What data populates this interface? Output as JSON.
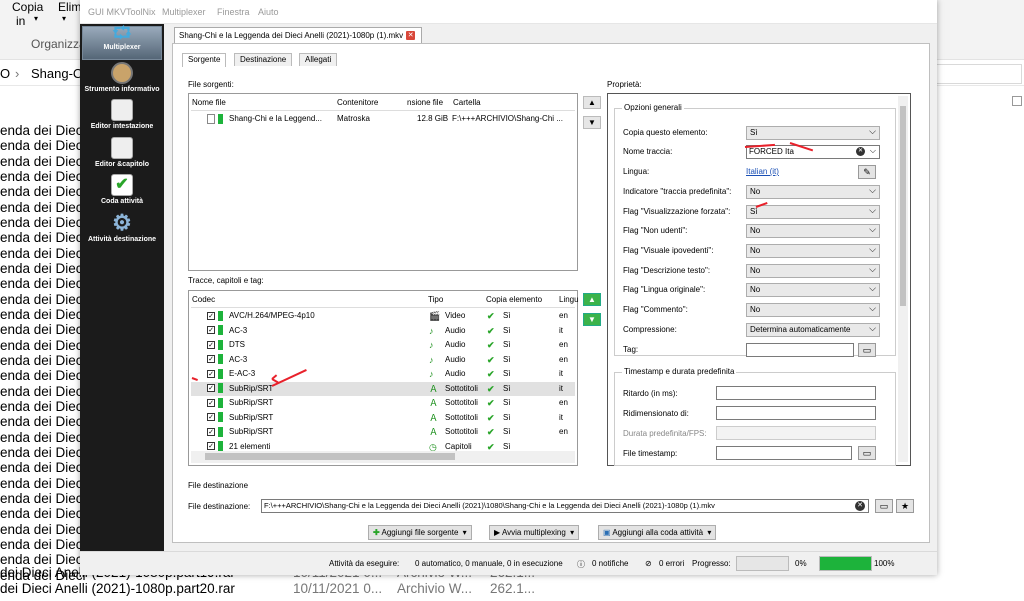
{
  "explorer": {
    "ribbon": {
      "copy_label": "Copia",
      "in_label": "in",
      "delete_label": "Elimi",
      "organize_label": "Organizza"
    },
    "address_left": "O",
    "address_path": "Shang-C",
    "rows": [
      "enda dei Dieci",
      "enda dei Dieci",
      "enda dei Dieci",
      "enda dei Dieci",
      "enda dei Dieci",
      "enda dei Dieci",
      "enda dei Dieci",
      "enda dei Dieci",
      "enda dei Dieci",
      "enda dei Dieci",
      "enda dei Dieci",
      "enda dei Dieci",
      "enda dei Dieci",
      "enda dei Dieci",
      "enda dei Dieci",
      "enda dei Dieci",
      "enda dei Dieci",
      "enda dei Dieci",
      "enda dei Dieci",
      "enda dei Dieci",
      "enda dei Dieci",
      "enda dei Dieci",
      "enda dei Dieci",
      "enda dei Dieci",
      "enda dei Dieci",
      "enda dei Dieci",
      "enda dei Dieci",
      "enda dei Dieci",
      "enda dei Dieci",
      "enda dei Dieci"
    ],
    "bottom_rows": [
      {
        "name": "dei Dieci Anelli (2021)-1080p.part19.rar",
        "date": "10/11/2021 0...",
        "type": "Archivio W...",
        "size": "262.1..."
      },
      {
        "name": "dei Dieci Anelli (2021)-1080p.part20.rar",
        "date": "10/11/2021 0...",
        "type": "Archivio W...",
        "size": "262.1..."
      }
    ]
  },
  "window": {
    "menu": [
      "GUI MKVToolNix",
      "Multiplexer",
      "Finestra",
      "Aiuto"
    ],
    "sidebar": [
      {
        "label": "Multiplexer",
        "icon": "multiplexer-icon"
      },
      {
        "label": "Strumento informativo",
        "icon": "magnifier-icon"
      },
      {
        "label": "Editor intestazione",
        "icon": "pencil-icon"
      },
      {
        "label": "Editor &capitolo",
        "icon": "chapter-editor-icon"
      },
      {
        "label": "Coda attività",
        "icon": "queue-check-icon"
      },
      {
        "label": "Attività destinazione",
        "icon": "gear-icon"
      }
    ],
    "file_tab": "Shang-Chi e la Leggenda dei Dieci Anelli (2021)-1080p (1).mkv",
    "subtabs": [
      "Sorgente",
      "Destinazione",
      "Allegati"
    ],
    "source_files": {
      "title": "File sorgenti:",
      "headers": [
        "Nome file",
        "Contenitore",
        "nsione file",
        "Cartella"
      ],
      "row": {
        "name": "Shang-Chi e la Leggend...",
        "container": "Matroska",
        "size": "12.8 GiB",
        "folder": "F:\\+++ARCHIVIO\\Shang-Chi ..."
      }
    },
    "tracks": {
      "title": "Tracce, capitoli e tag:",
      "headers": [
        "Codec",
        "Tipo",
        "Copia elemento",
        "Lingu"
      ],
      "rows": [
        {
          "codec": "AVC/H.264/MPEG-4p10",
          "type": "Video",
          "copy": "Sì",
          "lang": "en",
          "type_icon": "video-icon"
        },
        {
          "codec": "AC-3",
          "type": "Audio",
          "copy": "Sì",
          "lang": "it",
          "type_icon": "audio-note-icon"
        },
        {
          "codec": "DTS",
          "type": "Audio",
          "copy": "Sì",
          "lang": "en",
          "type_icon": "audio-note-icon"
        },
        {
          "codec": "AC-3",
          "type": "Audio",
          "copy": "Sì",
          "lang": "en",
          "type_icon": "audio-note-icon"
        },
        {
          "codec": "E-AC-3",
          "type": "Audio",
          "copy": "Sì",
          "lang": "it",
          "type_icon": "audio-note-icon"
        },
        {
          "codec": "SubRip/SRT",
          "type": "Sottotitoli",
          "copy": "Sì",
          "lang": "it",
          "type_icon": "subtitles-icon"
        },
        {
          "codec": "SubRip/SRT",
          "type": "Sottotitoli",
          "copy": "Sì",
          "lang": "en",
          "type_icon": "subtitles-icon"
        },
        {
          "codec": "SubRip/SRT",
          "type": "Sottotitoli",
          "copy": "Sì",
          "lang": "it",
          "type_icon": "subtitles-icon"
        },
        {
          "codec": "SubRip/SRT",
          "type": "Sottotitoli",
          "copy": "Sì",
          "lang": "en",
          "type_icon": "subtitles-icon"
        },
        {
          "codec": "21 elementi",
          "type": "Capitoli",
          "copy": "Sì",
          "lang": "",
          "type_icon": "chapters-icon"
        }
      ]
    },
    "properties": {
      "title": "Proprietà:",
      "general_title": "Opzioni generali",
      "fields": [
        {
          "label": "Copia questo elemento:",
          "value": "Sì"
        },
        {
          "label": "Nome traccia:",
          "value": "FORCED Ita"
        },
        {
          "label": "Lingua:",
          "value": "Italian (it)"
        },
        {
          "label": "Indicatore \"traccia predefinita\":",
          "value": "No"
        },
        {
          "label": "Flag \"Visualizzazione forzata\":",
          "value": "Sì"
        },
        {
          "label": "Flag \"Non udenti\":",
          "value": "No"
        },
        {
          "label": "Flag \"Visuale ipovedenti\":",
          "value": "No"
        },
        {
          "label": "Flag \"Descrizione testo\":",
          "value": "No"
        },
        {
          "label": "Flag \"Lingua originale\":",
          "value": "No"
        },
        {
          "label": "Flag \"Commento\":",
          "value": "No"
        },
        {
          "label": "Compressione:",
          "value": "Determina automaticamente"
        },
        {
          "label": "Tag:",
          "value": ""
        }
      ],
      "timestamp_title": "Timestamp e durata predefinita",
      "timestamp_fields": [
        "Ritardo (in ms):",
        "Ridimensionato di:",
        "Durata predefinita/FPS:",
        "File timestamp:"
      ]
    },
    "destination": {
      "title": "File destinazione",
      "label": "File destinazione:",
      "value": "F:\\+++ARCHIVIO\\Shang-Chi e la Leggenda dei Dieci Anelli (2021)\\1080\\Shang-Chi e la Leggenda dei Dieci Anelli (2021)-1080p (1).mkv"
    },
    "buttons": {
      "add": "Aggiungi file sorgente",
      "start": "Avvia multiplexing",
      "queue": "Aggiungi alla coda attività"
    },
    "status": {
      "tasks": "Attività da eseguire:",
      "tasks_value": "0 automatico, 0 manuale, 0 in esecuzione",
      "notices": "0 notifiche",
      "errors": "0 errori",
      "progress_label": "Progresso:",
      "progress1": "0%",
      "progress2": "100%",
      "progress1_fraction": 0,
      "progress2_fraction": 1.0
    }
  },
  "colors": {
    "accent_green": "#1db33b",
    "arrow_red": "#e8212b",
    "sidebar_bg": "#1b1b1b"
  }
}
